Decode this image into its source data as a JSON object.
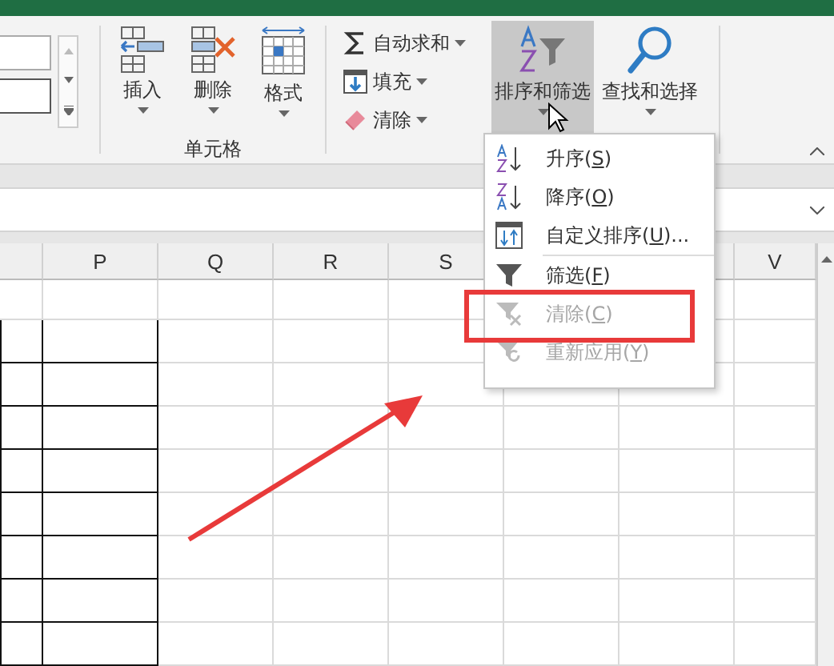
{
  "ribbon": {
    "cells_group": {
      "buttons": [
        {
          "label": "插入",
          "kind": "insert"
        },
        {
          "label": "删除",
          "kind": "delete"
        },
        {
          "label": "格式",
          "kind": "format"
        }
      ],
      "label": "单元格"
    },
    "editing_group": {
      "small_buttons": [
        {
          "label": "自动求和",
          "kind": "sum"
        },
        {
          "label": "填充",
          "kind": "fill"
        },
        {
          "label": "清除",
          "kind": "clear"
        }
      ],
      "large_buttons": [
        {
          "label": "排序和筛选",
          "kind": "sort",
          "selected": true
        },
        {
          "label": "查找和选择",
          "kind": "find",
          "selected": false
        }
      ]
    }
  },
  "sort_menu": {
    "items": [
      {
        "kind": "ascending",
        "label": "升序",
        "shortcut": "(S)",
        "disabled": false
      },
      {
        "kind": "descending",
        "label": "降序",
        "shortcut": "(O)",
        "disabled": false
      },
      {
        "kind": "custom",
        "label": "自定义排序",
        "shortcut": "(U)",
        "after": "...",
        "disabled": false
      },
      {
        "kind": "filter",
        "label": "筛选",
        "shortcut": "(F)",
        "disabled": false
      },
      {
        "kind": "clear",
        "label": "清除",
        "shortcut": "(C)",
        "disabled": true
      },
      {
        "kind": "reapply",
        "label": "重新应用",
        "shortcut": "(Y)",
        "disabled": true
      }
    ]
  },
  "sheet": {
    "column_headers": [
      "P",
      "Q",
      "R",
      "S",
      "V"
    ]
  }
}
